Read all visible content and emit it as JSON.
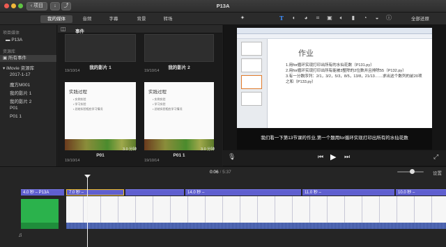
{
  "window": {
    "title": "P13A",
    "back_button": "项目",
    "restore_all": "全部还原"
  },
  "tabs": [
    "我的媒体",
    "音频",
    "字幕",
    "背景",
    "转场"
  ],
  "sidebar": {
    "project_media_heading": "项目媒体",
    "project_item": "P13A",
    "library_heading": "资源库",
    "all_events": "所有事件",
    "imovie_library": "iMovie 资源库",
    "events": [
      "2017-1-17",
      "魔方M001",
      "我的影片 1",
      "我的影片 2",
      "P01",
      "P01 1"
    ]
  },
  "browser": {
    "header": "事件",
    "clips": [
      {
        "label": "我的影片 1",
        "date": "19/10/14"
      },
      {
        "label": "我的影片 2",
        "date": "19/10/14"
      },
      {
        "label": "P01",
        "date": "19/10/14",
        "duration": "3.0 分钟"
      },
      {
        "label": "P01 1",
        "date": "19/10/14",
        "duration": "3.0 分钟"
      }
    ],
    "thumb_title": "实践过程",
    "thumb_bullets": [
      "• 实例实验",
      "• 学习实验",
      "• 总结实验相应学习情况"
    ]
  },
  "viewer": {
    "slide_title": "作业",
    "slide_lines": [
      "1.用for循环实现打印出所有的水仙花数（P131.py）",
      "2.用for循环实现打印出所有能被3整除的2位数并且排除55（P132.py）",
      "3.有一分数序列：2/1，3/2，5/3，8/5，13/8，21/13……求出这个数列的前20项之和（P133.py）"
    ],
    "subtitle": "我们看一下第13节课的作业,第一个题用for循环实现打印出所有的水仙花数",
    "timecode_current": "0:06",
    "timecode_total": "5:37",
    "settings_label": "设置"
  },
  "timeline": {
    "first_clip_label": "4.0 秒 – P13A",
    "segments": [
      "7.0 秒 –",
      "",
      "14.0 秒 –",
      "11.0 秒 –",
      "10.0 秒 –"
    ]
  },
  "colors": {
    "accent_blue": "#3f8cf5",
    "clip_purple": "#5f5fcf",
    "selection_yellow": "#f2c033",
    "green_clip": "#2bb24c"
  }
}
